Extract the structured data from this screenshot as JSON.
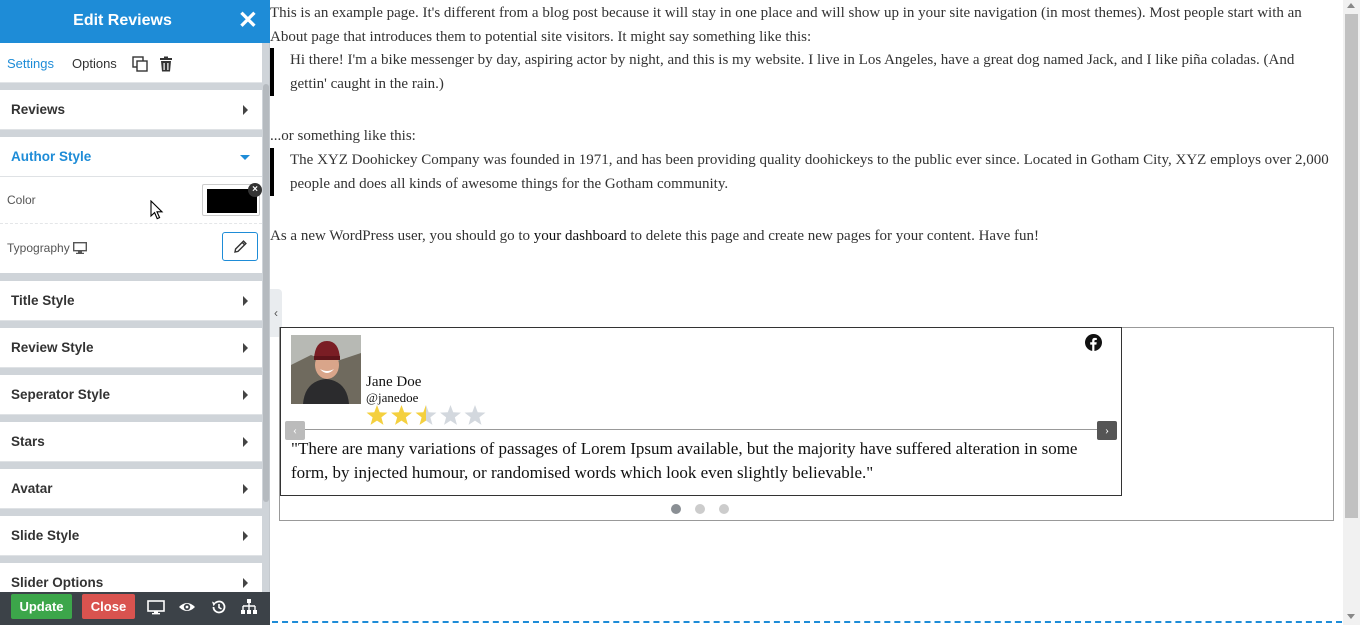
{
  "panel": {
    "title": "Edit Reviews",
    "close_glyph": "✕",
    "tabs": {
      "settings": "Settings",
      "options": "Options"
    },
    "sections": {
      "reviews": "Reviews",
      "author_style": "Author Style",
      "title_style": "Title Style",
      "review_style": "Review Style",
      "separator_style": "Seperator Style",
      "stars": "Stars",
      "avatar": "Avatar",
      "slide_style": "Slide Style",
      "slider_options": "Slider Options"
    },
    "author_style": {
      "color_label": "Color",
      "color_value": "#000000",
      "typography_label": "Typography"
    },
    "footer": {
      "update": "Update",
      "close": "Close"
    },
    "collapse_glyph": "‹",
    "accent_color": "#1e8cd7"
  },
  "page": {
    "paragraph_1": "This is an example page. It's different from a blog post because it will stay in one place and will show up in your site navigation (in most themes). Most people start with an About page that introduces them to potential site visitors. It might say something like this:",
    "quote_1": "Hi there! I'm a bike messenger by day, aspiring actor by night, and this is my website. I live in Los Angeles, have a great dog named Jack, and I like piña coladas. (And gettin' caught in the rain.)",
    "paragraph_2": "...or something like this:",
    "quote_2": "The XYZ Doohickey Company was founded in 1971, and has been providing quality doohickeys to the public ever since. Located in Gotham City, XYZ employs over 2,000 people and does all kinds of awesome things for the Gotham community.",
    "paragraph_3_before": "As a new WordPress user, you should go to ",
    "paragraph_3_link": "your dashboard",
    "paragraph_3_after": " to delete this page and create new pages for your content. Have fun!"
  },
  "review": {
    "author_name": "Jane Doe",
    "author_handle": "@janedoe",
    "rating": 2.5,
    "rating_max": 5,
    "text": "\"There are many variations of passages of Lorem Ipsum available, but the majority have suffered alteration in some form, by injected humour, or randomised words which look even slightly believable.\"",
    "prev_glyph": "‹",
    "next_glyph": "›",
    "slide_count": 3,
    "active_slide": 1,
    "star_color": "#f4d03f",
    "star_empty_color": "#d3d8de"
  }
}
